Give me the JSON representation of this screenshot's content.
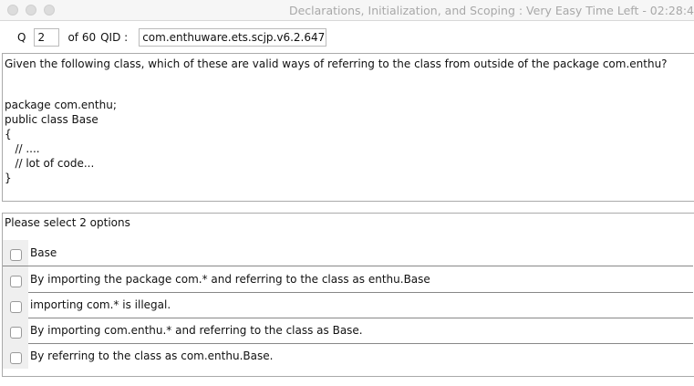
{
  "window": {
    "title": "Declarations, Initialization, and Scoping  :  Very Easy   Time Left - 02:28:4"
  },
  "header": {
    "q_label": "Q",
    "q_number": "2",
    "of_label": "of 60",
    "qid_label": "QID :",
    "qid": "com.enthuware.ets.scjp.v6.2.647"
  },
  "question": {
    "text": "Given the following class, which of these are valid ways of referring to the class from outside of the package com.enthu?",
    "code": "package com.enthu;\npublic class Base\n{\n   // ....\n   // lot of code...\n}"
  },
  "options": {
    "prompt": "Please select 2 options",
    "items": [
      {
        "label": "Base",
        "checked": false
      },
      {
        "label": "By importing the package com.* and referring to the class as enthu.Base",
        "checked": false
      },
      {
        "label": "importing com.* is illegal.",
        "checked": false
      },
      {
        "label": "By importing com.enthu.* and referring to the class as Base.",
        "checked": false
      },
      {
        "label": "By referring to the class as com.enthu.Base.",
        "checked": false
      }
    ]
  }
}
